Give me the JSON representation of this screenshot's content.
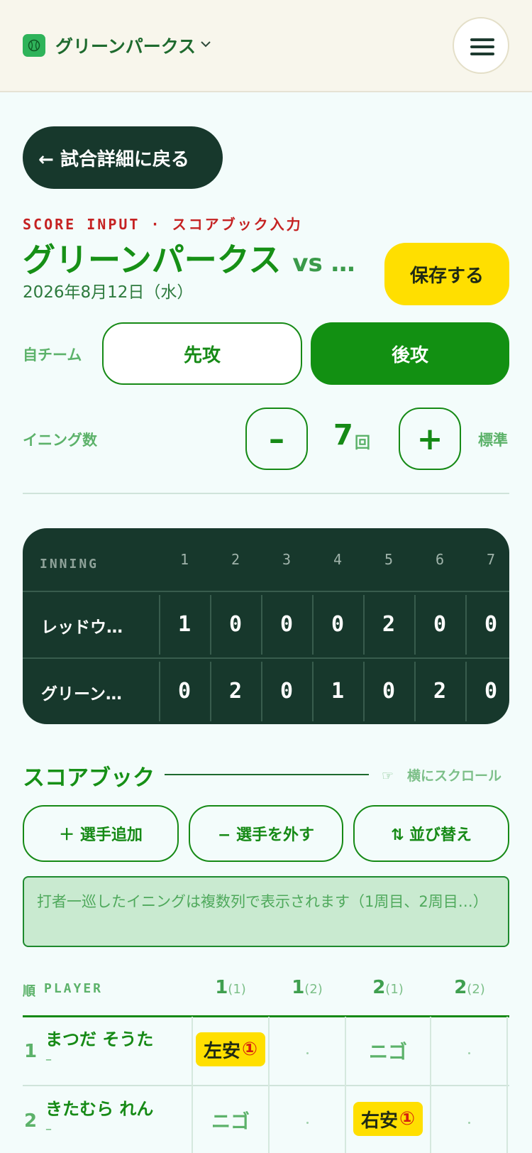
{
  "header": {
    "team_name": "グリーンパークス",
    "logo_icon": "baseball-icon",
    "dropdown_icon": "chevron-down-icon",
    "menu_icon": "hamburger-menu-icon"
  },
  "back_button": {
    "label": "← 試合詳細に戻る"
  },
  "title_block": {
    "kicker": "SCORE INPUT · スコアブック入力",
    "title": "グリーンパークス",
    "vs": "vs …",
    "date": "2026年8月12日（水）",
    "save_label": "保存する"
  },
  "batting_order": {
    "label": "自チーム",
    "first_label": "先攻",
    "second_label": "後攻",
    "selected": "後攻"
  },
  "innings": {
    "label": "イニング数",
    "minus_label": "–",
    "value": "7",
    "unit": "回",
    "plus_label": "+",
    "standard_label": "標準"
  },
  "scoreboard": {
    "header": "INNING",
    "innings": [
      "1",
      "2",
      "3",
      "4",
      "5",
      "6",
      "7"
    ],
    "rows": [
      {
        "team": "レッドウ…",
        "scores": [
          "1",
          "0",
          "0",
          "0",
          "2",
          "0",
          "0"
        ]
      },
      {
        "team": "グリーン…",
        "scores": [
          "0",
          "2",
          "0",
          "1",
          "0",
          "2",
          "0"
        ]
      }
    ]
  },
  "scorebook": {
    "title": "スコアブック",
    "scroll_hint": "☞　横にスクロール",
    "add_player": "＋ 選手追加",
    "remove_player": "− 選手を外す",
    "reorder": "⇅ 並び替え",
    "notice": "打者一巡したイニングは複数列で表示されます（1周目、2周目…）",
    "col_order": "順",
    "col_player": "PLAYER",
    "columns": [
      {
        "inning": "1",
        "round": "(1)"
      },
      {
        "inning": "1",
        "round": "(2)"
      },
      {
        "inning": "2",
        "round": "(1)"
      },
      {
        "inning": "2",
        "round": "(2)"
      }
    ],
    "players": [
      {
        "no": "1",
        "name": "まつだ そうた",
        "sub": "–",
        "results": [
          {
            "text": "左安",
            "circled": "①",
            "hit": true
          },
          {
            "text": "",
            "hit": false
          },
          {
            "text": "ニゴ",
            "hit": false
          },
          {
            "text": "",
            "hit": false
          }
        ]
      },
      {
        "no": "2",
        "name": "きたむら れん",
        "sub": "–",
        "results": [
          {
            "text": "ニゴ",
            "hit": false
          },
          {
            "text": "",
            "hit": false
          },
          {
            "text": "右安",
            "circled": "①",
            "hit": true
          },
          {
            "text": "",
            "hit": false
          }
        ]
      }
    ]
  },
  "colors": {
    "primary_green": "#129012",
    "dark_green": "#17382c",
    "accent_yellow": "#ffdf00",
    "kicker_red": "#c52222",
    "background": "#f3fcfb"
  }
}
